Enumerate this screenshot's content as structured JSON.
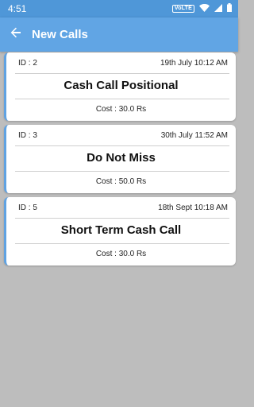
{
  "status_bar": {
    "time": "4:51",
    "network_badge": "VoLTE"
  },
  "app_bar": {
    "title": "New Calls",
    "back_icon": "arrow-left-icon"
  },
  "colors": {
    "status_bar": "#4f97d8",
    "app_bar": "#61a5e4",
    "card_accent": "#5fa2e2",
    "background": "#bdbdbd"
  },
  "calls": [
    {
      "id": "ID : 2",
      "date": "19th July 10:12 AM",
      "title": "Cash Call Positional",
      "cost": "Cost : 30.0 Rs"
    },
    {
      "id": "ID : 3",
      "date": "30th July 11:52 AM",
      "title": "Do Not Miss",
      "cost": "Cost : 50.0 Rs"
    },
    {
      "id": "ID : 5",
      "date": "18th Sept 10:18 AM",
      "title": "Short Term Cash Call",
      "cost": "Cost : 30.0 Rs"
    }
  ]
}
